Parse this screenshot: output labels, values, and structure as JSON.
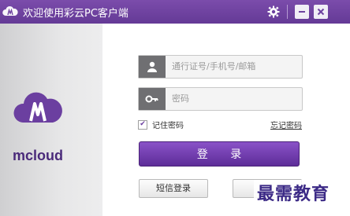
{
  "window": {
    "title": "欢迎使用彩云PC客户端",
    "settings_icon": "gear-icon",
    "minimize_icon": "minimize-icon",
    "close_icon": "close-icon"
  },
  "brand": {
    "logo_text": "mcloud",
    "logo_icon": "cloud-m-logo"
  },
  "login": {
    "account_placeholder": "通行证号/手机号/邮箱",
    "password_placeholder": "密码",
    "remember_label": "记住密码",
    "remember_checked": true,
    "forgot_label": "忘记密码",
    "login_label": "登 录",
    "sms_login_label": "短信登录",
    "other_button_label": ""
  },
  "watermark": "最需教育",
  "colors": {
    "accent": "#6b3fa0",
    "titlebar": "#6e42a0"
  }
}
